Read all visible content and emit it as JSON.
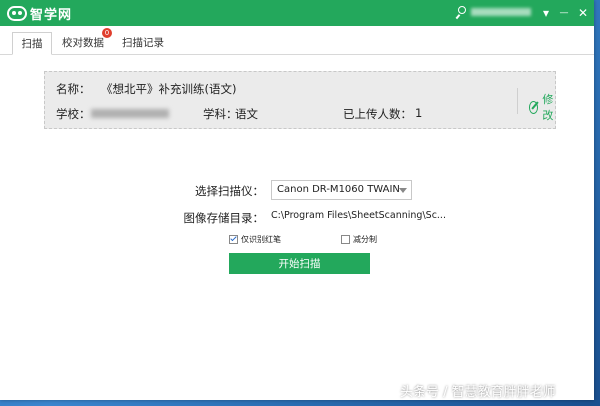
{
  "app": {
    "title": "智学网"
  },
  "window_controls": {
    "minimize": "—",
    "close": "✕",
    "menu": "▾"
  },
  "tabs": [
    {
      "label": "扫描"
    },
    {
      "label": "校对数据",
      "badge": "0"
    },
    {
      "label": "扫描记录"
    }
  ],
  "exam": {
    "name_label": "名称：",
    "name": "《想北平》补充训练(语文)",
    "school_label": "学校：",
    "subject_label": "学科：",
    "subject": "语文",
    "uploaded_label": "已上传人数：",
    "uploaded_count": "1",
    "edit_label": "修改"
  },
  "form": {
    "scanner_label": "选择扫描仪：",
    "scanner_value": "Canon DR-M1060 TWAIN",
    "dir_label": "图像存储目录：",
    "dir_value": "C:\\Program Files\\SheetScanning\\Sc...",
    "opt1_label": "仅识别红笔",
    "opt1_checked": true,
    "opt2_label": "减分制",
    "opt2_checked": false,
    "start_label": "开始扫描"
  },
  "watermark": "头条号 / 智慧教育胖胖老师",
  "colors": {
    "brand": "#23a85c",
    "badge": "#e03e2d"
  }
}
